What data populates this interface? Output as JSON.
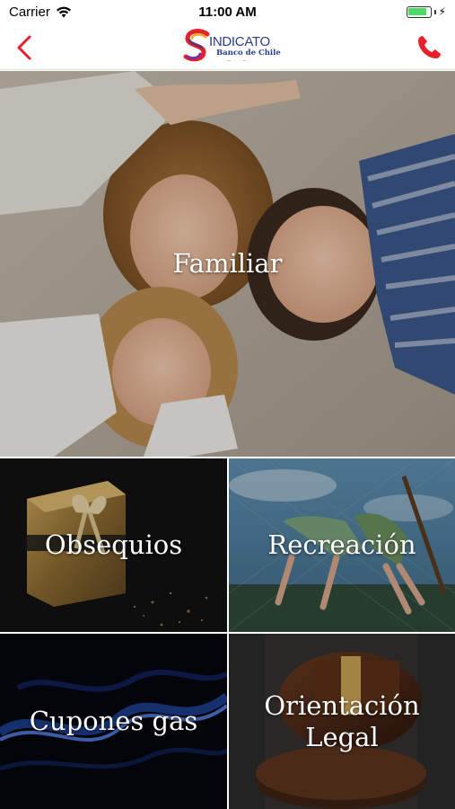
{
  "status_bar": {
    "carrier": "Carrier",
    "time": "11:00 AM",
    "battery_level": 0.85
  },
  "nav": {
    "logo_name": "INDICATO",
    "logo_sub": "Banco de Chile"
  },
  "colors": {
    "accent": "#e8202a",
    "brand_blue": "#2a3d8f"
  },
  "icons": {
    "back": "chevron-left-icon",
    "phone": "phone-icon"
  },
  "tiles": [
    {
      "label": "Familiar"
    },
    {
      "label": "Obsequios"
    },
    {
      "label": "Recreación"
    },
    {
      "label": "Cupones gas"
    },
    {
      "label_line1": "Orientación",
      "label_line2": "Legal"
    }
  ]
}
